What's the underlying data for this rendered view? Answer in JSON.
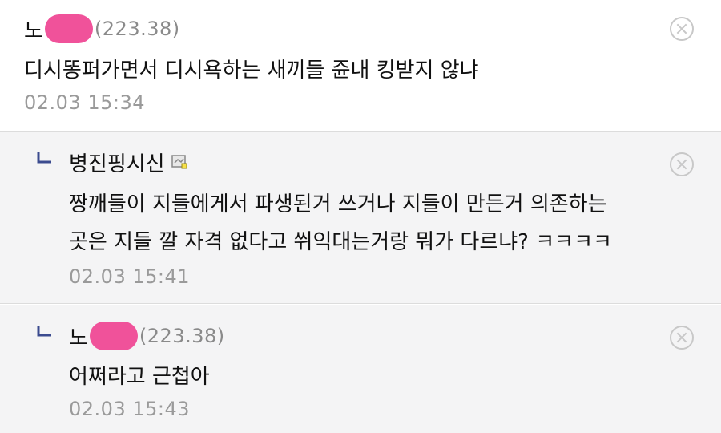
{
  "comments": [
    {
      "nickname": "노",
      "ip": "(223.38)",
      "text": "디시똥퍼가면서 디시욕하는 새끼들 쥰내 킹받지 않냐",
      "date": "02.03 15:34"
    },
    {
      "nickname": "병진핑시신",
      "text_line1": "짱깨들이 지들에게서 파생된거 쓰거나 지들이 만든거 의존하는",
      "text_line2": "곳은 지들 깔 자격 없다고 쒸익대는거랑 뭐가 다르냐? ㅋㅋㅋㅋ",
      "date": "02.03 15:41"
    },
    {
      "nickname": "노",
      "ip": "(223.38)",
      "text": "어쩌라고 근첩아",
      "date": "02.03 15:43"
    }
  ],
  "colors": {
    "mask": "#f0529a",
    "reply_mark": "#3b4b8f",
    "meta_text": "#9a9a9a",
    "reply_bg": "#f4f4f5"
  },
  "icons": {
    "reply": "reply-arrow-icon",
    "gallog": "gallog-user-icon",
    "delete": "close-circle-icon"
  }
}
